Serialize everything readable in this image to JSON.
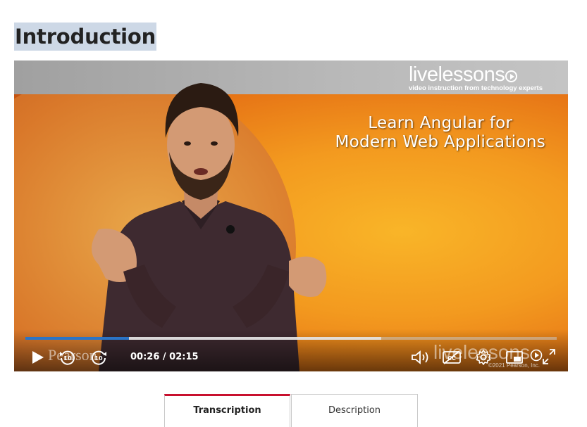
{
  "page": {
    "title": "Introduction"
  },
  "video": {
    "brand_live": "live",
    "brand_lessons": "lessons",
    "brand_tagline": "video instruction from technology experts",
    "headline_line1": "Learn Angular for",
    "headline_line2": "Modern Web Applications",
    "time_display": "00:26 / 02:15",
    "progress_played": 0.195,
    "progress_buffered": 0.67,
    "watermark_publisher": "Pearson",
    "watermark_live": "livelessons",
    "watermark_copyright": "©2021 Pearson, Inc.",
    "skip_back_seconds": "10",
    "skip_forward_seconds": "10"
  },
  "controls": {
    "play": "play-icon",
    "rewind": "rewind-10-icon",
    "forward": "forward-10-icon",
    "volume": "volume-icon",
    "captions": "captions-off-icon",
    "settings": "gear-icon",
    "pip": "picture-in-picture-icon",
    "mini_player": "mini-player-icon",
    "fullscreen": "fullscreen-icon"
  },
  "tabs": [
    {
      "label": "Transcription",
      "active": true
    },
    {
      "label": "Description",
      "active": false
    }
  ],
  "colors": {
    "progress": "#2a74c6",
    "active_tab_border": "#c8102e",
    "title_highlight": "#cdd8e6"
  }
}
